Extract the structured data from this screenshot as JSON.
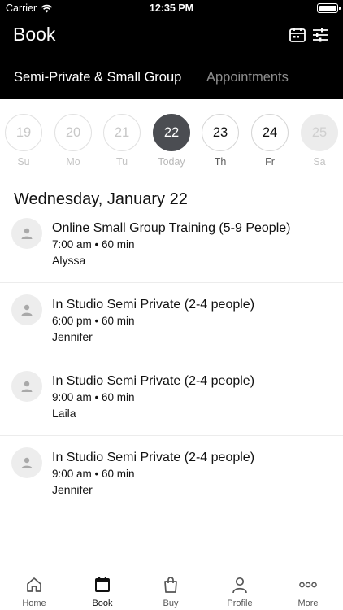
{
  "status_bar": {
    "carrier": "Carrier",
    "time": "12:35 PM"
  },
  "header": {
    "title": "Book",
    "tabs": [
      {
        "label": "Semi-Private & Small Group",
        "active": true
      },
      {
        "label": "Appointments",
        "active": false
      }
    ]
  },
  "date_strip": {
    "days": [
      {
        "number": "19",
        "label": "Su",
        "state": "disabled"
      },
      {
        "number": "20",
        "label": "Mo",
        "state": "disabled"
      },
      {
        "number": "21",
        "label": "Tu",
        "state": "disabled"
      },
      {
        "number": "22",
        "label": "Today",
        "state": "selected"
      },
      {
        "number": "23",
        "label": "Th",
        "state": "available"
      },
      {
        "number": "24",
        "label": "Fr",
        "state": "available"
      },
      {
        "number": "25",
        "label": "Sa",
        "state": "unavailable"
      }
    ]
  },
  "schedule": {
    "heading": "Wednesday, January 22",
    "classes": [
      {
        "name": "Online Small Group Training (5-9 People)",
        "time": "7:00 am • 60 min",
        "instructor": "Alyssa"
      },
      {
        "name": "In Studio Semi Private (2-4 people)",
        "time": "6:00 pm • 60 min",
        "instructor": "Jennifer"
      },
      {
        "name": "In Studio Semi Private (2-4 people)",
        "time": "9:00 am • 60 min",
        "instructor": "Laila"
      },
      {
        "name": "In Studio Semi Private (2-4 people)",
        "time": "9:00 am • 60 min",
        "instructor": "Jennifer"
      }
    ]
  },
  "tab_bar": {
    "items": [
      {
        "label": "Home",
        "icon": "home-icon"
      },
      {
        "label": "Book",
        "icon": "calendar-icon",
        "active": true
      },
      {
        "label": "Buy",
        "icon": "shopping-bag-icon"
      },
      {
        "label": "Profile",
        "icon": "person-icon"
      },
      {
        "label": "More",
        "icon": "more-dots-icon"
      }
    ]
  },
  "colors": {
    "header_bg": "#000000",
    "selected_day": "#4b4d52",
    "accent_text": "#111111"
  }
}
